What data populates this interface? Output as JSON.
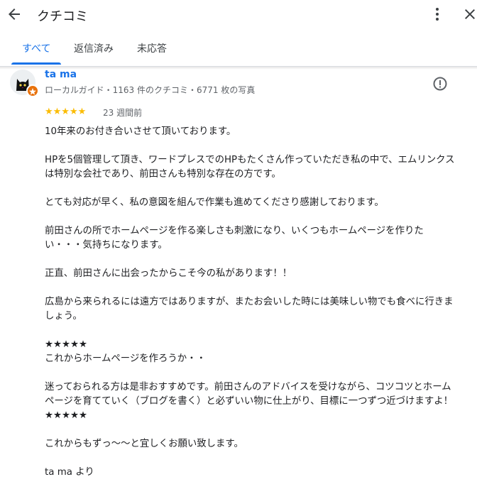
{
  "header": {
    "title": "クチコミ"
  },
  "tabs": [
    {
      "label": "すべて"
    },
    {
      "label": "返信済み"
    },
    {
      "label": "未応答"
    }
  ],
  "review": {
    "author": "ta ma",
    "meta": "ローカルガイド・1163 件のクチコミ・6771 枚の写真",
    "rating": 5,
    "stars": "★★★★★",
    "date": "23 週間前",
    "paragraphs": [
      "10年来のお付き合いさせて頂いております。",
      "HPを5個管理して頂き、ワードプレスでのHPもたくさん作っていただき私の中で、エムリンクスは特別な会社であり、前田さんも特別な存在の方です。",
      "とても対応が早く、私の意図を組んで作業も進めてくださり感謝しております。",
      "前田さんの所でホームページを作る楽しさも刺激になり、いくつもホームページを作りたい・・・気持ちになります。",
      "正直、前田さんに出会ったからこそ今の私があります！！",
      "広島から来られるには遠方ではありますが、またお会いした時には美味しい物でも食べに行きましょう。",
      "★★★★★\nこれからホームページを作ろうか・・",
      "迷っておられる方は是非おすすめです。前田さんのアドバイスを受けながら、コツコツとホームページを育てていく（ブログを書く）と必ずいい物に仕上がり、目標に一つずつ近づけますよ！\n★★★★★",
      "これからもずっ〜〜と宜しくお願い致します。",
      "ta ma より"
    ]
  },
  "icons": {
    "back": "arrow-back-icon",
    "more": "more-vert-icon",
    "close": "close-icon",
    "flag": "report-icon",
    "badge": "local-guide-badge-icon",
    "avatar": "black-cat-avatar"
  },
  "colors": {
    "accent": "#1a73e8",
    "star": "#fbbc04",
    "badge": "#e8710a",
    "secondary_text": "#5f6368"
  }
}
